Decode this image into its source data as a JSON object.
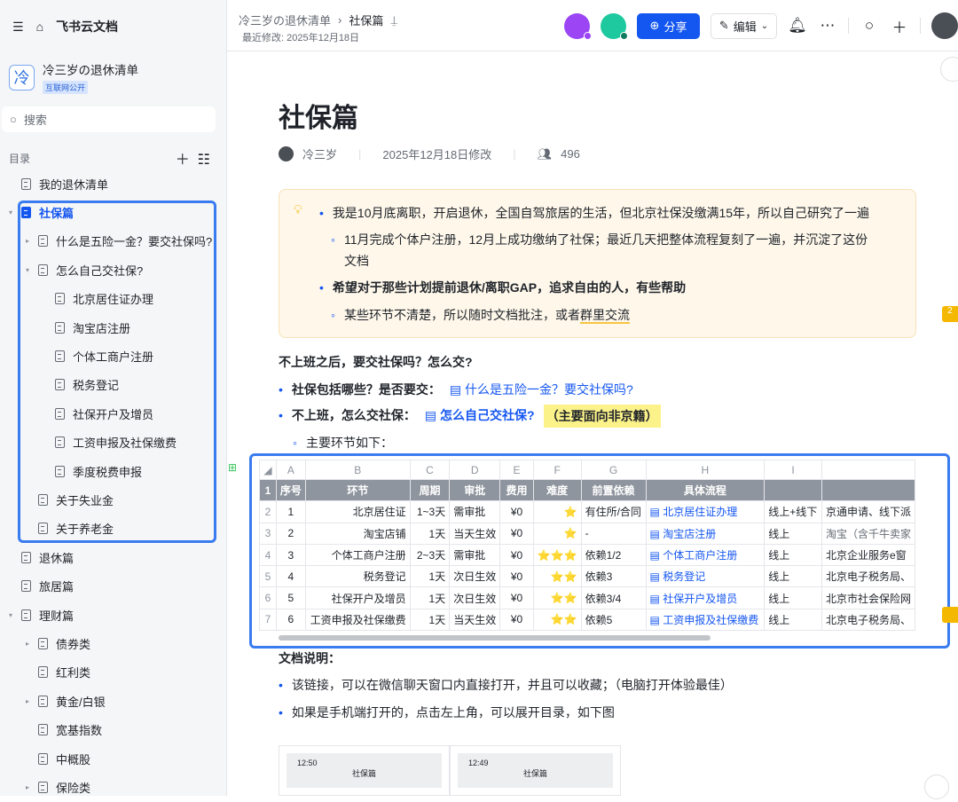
{
  "sidebar": {
    "home_label": "飞书云文档",
    "space_name": "冷三岁の退休清单",
    "space_logo": "冷",
    "space_badge": "互联网公开",
    "search_placeholder": "搜索",
    "toc_label": "目录",
    "items": [
      {
        "label": "我的退休清单",
        "level": 0,
        "arrow": ""
      },
      {
        "label": "社保篇",
        "level": 0,
        "arrow": "▾",
        "selected": true
      },
      {
        "label": "什么是五险一金？要交社保吗?",
        "level": 1,
        "arrow": "▸"
      },
      {
        "label": "怎么自己交社保?",
        "level": 1,
        "arrow": "▾"
      },
      {
        "label": "北京居住证办理",
        "level": 2,
        "arrow": ""
      },
      {
        "label": "淘宝店注册",
        "level": 2,
        "arrow": ""
      },
      {
        "label": "个体工商户注册",
        "level": 2,
        "arrow": ""
      },
      {
        "label": "税务登记",
        "level": 2,
        "arrow": ""
      },
      {
        "label": "社保开户及增员",
        "level": 2,
        "arrow": ""
      },
      {
        "label": "工资申报及社保缴费",
        "level": 2,
        "arrow": ""
      },
      {
        "label": "季度税费申报",
        "level": 2,
        "arrow": ""
      },
      {
        "label": "关于失业金",
        "level": 1,
        "arrow": ""
      },
      {
        "label": "关于养老金",
        "level": 1,
        "arrow": ""
      },
      {
        "label": "退休篇",
        "level": 0,
        "arrow": ""
      },
      {
        "label": "旅居篇",
        "level": 0,
        "arrow": ""
      },
      {
        "label": "理财篇",
        "level": 0,
        "arrow": "▾"
      },
      {
        "label": "债券类",
        "level": 1,
        "arrow": "▸"
      },
      {
        "label": "红利类",
        "level": 1,
        "arrow": ""
      },
      {
        "label": "黄金/白银",
        "level": 1,
        "arrow": "▸"
      },
      {
        "label": "宽基指数",
        "level": 1,
        "arrow": ""
      },
      {
        "label": "中概股",
        "level": 1,
        "arrow": ""
      },
      {
        "label": "保险类",
        "level": 1,
        "arrow": "▸"
      }
    ]
  },
  "topbar": {
    "breadcrumb_parent": "冷三岁の退休清单",
    "breadcrumb_current": "社保篇",
    "modified": "最近修改: 2025年12月18日",
    "share_label": "分享",
    "edit_label": "编辑"
  },
  "doc": {
    "title": "社保篇",
    "author": "冷三岁",
    "modified": "2025年12月18日修改",
    "views": "496",
    "callout": {
      "l1": "我是10月底离职，开启退休，全国自驾旅居的生活，但北京社保没缴满15年，所以自己研究了一遍",
      "l1a": "11月完成个体户注册，12月上成功缴纳了社保；最近几天把整体流程复刻了一遍，并沉淀了这份",
      "l1b": "文档",
      "l2": "希望对于那些计划提前退休/离职GAP，追求自由的人，有些帮助",
      "l3a": "某些环节不清楚，所以随时文档批注，或者",
      "l3b": "群里交流"
    },
    "q_heading": "不上班之后，要交社保吗？怎么交?",
    "b1_label": "社保包括哪些？是否要交：",
    "b1_link": "什么是五险一金？要交社保吗?",
    "b2_label": "不上班，怎么交社保：",
    "b2_link": "怎么自己交社保?",
    "b2_note": "（主要面向非京籍）",
    "b3": "主要环节如下：",
    "notes_heading": "文档说明：",
    "n1": "该链接，可以在微信聊天窗口内直接打开，并且可以收藏；（电脑打开体验最佳）",
    "n2": "如果是手机端打开的，点击左上角，可以展开目录，如下图",
    "phone1_time": "12:50",
    "phone2_time": "12:49",
    "phone_title": "社保篇",
    "comment_count": "2"
  },
  "table": {
    "cols": [
      "A",
      "B",
      "C",
      "D",
      "E",
      "F",
      "G",
      "H",
      "I",
      ""
    ],
    "headers": [
      "序号",
      "环节",
      "周期",
      "审批",
      "费用",
      "难度",
      "前置依赖",
      "具体流程",
      "",
      ""
    ],
    "rows": [
      [
        "1",
        "北京居住证",
        "1~3天",
        "需审批",
        "¥0",
        "⭐",
        "有住所/合同",
        "北京居住证办理",
        "线上+线下",
        "京通申请、线下派"
      ],
      [
        "2",
        "淘宝店铺",
        "1天",
        "当天生效",
        "¥0",
        "⭐",
        "-",
        "淘宝店注册",
        "线上",
        "淘宝（含千牛卖家"
      ],
      [
        "3",
        "个体工商户注册",
        "2~3天",
        "需审批",
        "¥0",
        "⭐⭐⭐",
        "依赖1/2",
        "个体工商户注册",
        "线上",
        "北京企业服务e窗"
      ],
      [
        "4",
        "税务登记",
        "1天",
        "次日生效",
        "¥0",
        "⭐⭐",
        "依赖3",
        "税务登记",
        "线上",
        "北京电子税务局、"
      ],
      [
        "5",
        "社保开户及增员",
        "1天",
        "次日生效",
        "¥0",
        "⭐⭐",
        "依赖3/4",
        "社保开户及增员",
        "线上",
        "北京市社会保险网"
      ],
      [
        "6",
        "工资申报及社保缴费",
        "1天",
        "当天生效",
        "¥0",
        "⭐⭐",
        "依赖5",
        "工资申报及社保缴费",
        "线上",
        "北京电子税务局、"
      ]
    ]
  }
}
